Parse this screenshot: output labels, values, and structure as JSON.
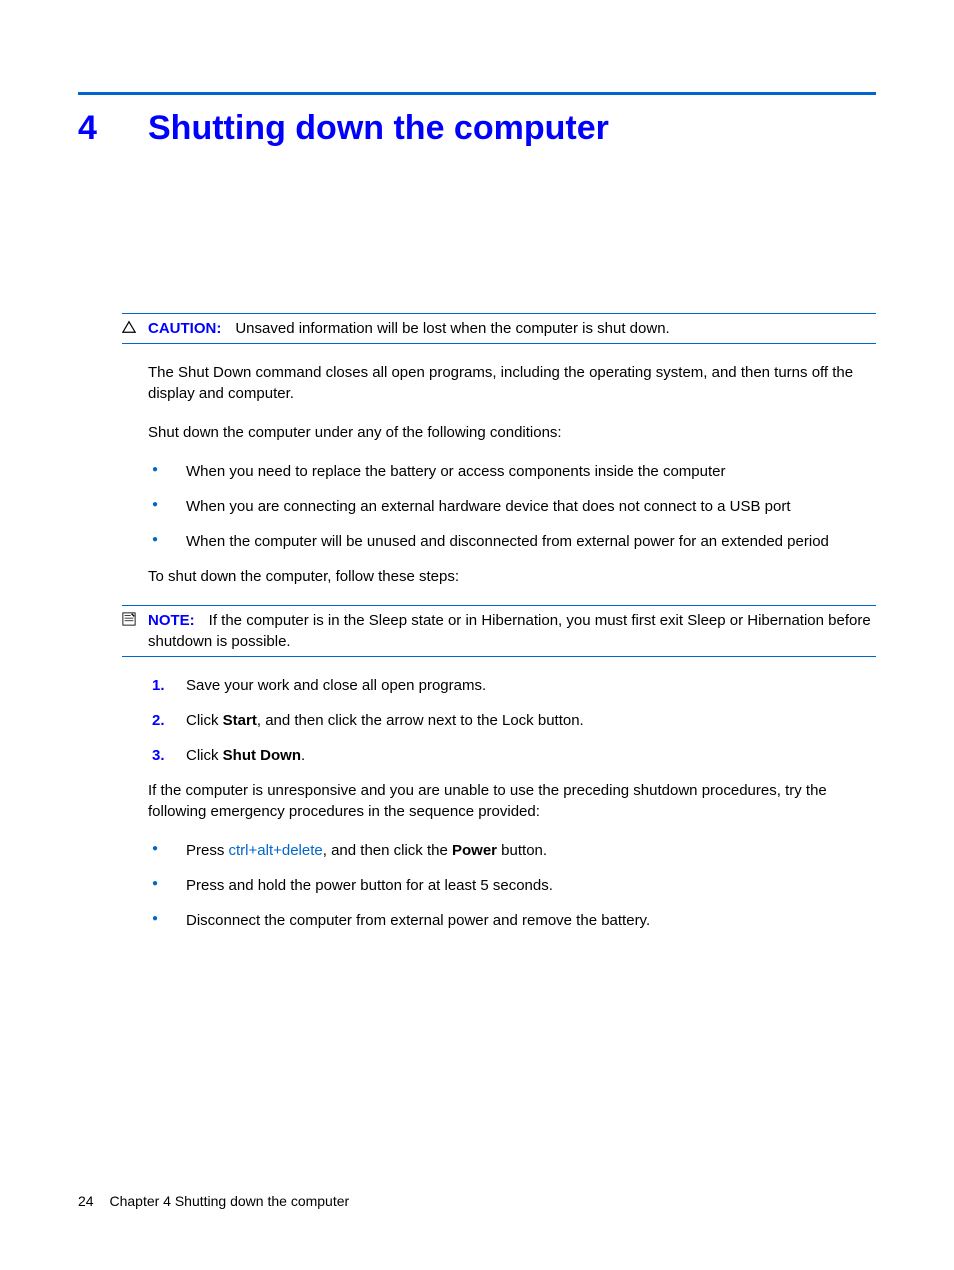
{
  "chapter": {
    "number": "4",
    "title": "Shutting down the computer"
  },
  "caution": {
    "label": "CAUTION:",
    "text": "Unsaved information will be lost when the computer is shut down."
  },
  "paras": {
    "intro1": "The Shut Down command closes all open programs, including the operating system, and then turns off the display and computer.",
    "intro2": "Shut down the computer under any of the following conditions:",
    "steps_intro": "To shut down the computer, follow these steps:",
    "unresponsive": "If the computer is unresponsive and you are unable to use the preceding shutdown procedures, try the following emergency procedures in the sequence provided:"
  },
  "conditions": [
    "When you need to replace the battery or access components inside the computer",
    "When you are connecting an external hardware device that does not connect to a USB port",
    "When the computer will be unused and disconnected from external power for an extended period"
  ],
  "note": {
    "label": "NOTE:",
    "text": "If the computer is in the Sleep state or in Hibernation, you must first exit Sleep or Hibernation before shutdown is possible."
  },
  "steps": [
    {
      "n": "1.",
      "pre": "Save your work and close all open programs."
    },
    {
      "n": "2.",
      "pre": "Click ",
      "bold": "Start",
      "post": ", and then click the arrow next to the Lock button."
    },
    {
      "n": "3.",
      "pre": "Click ",
      "bold": "Shut Down",
      "post": "."
    }
  ],
  "emergency": [
    {
      "pre": "Press ",
      "kbd": "ctrl+alt+delete",
      "mid": ", and then click the ",
      "bold": "Power",
      "post": " button."
    },
    {
      "pre": "Press and hold the power button for at least 5 seconds."
    },
    {
      "pre": "Disconnect the computer from external power and remove the battery."
    }
  ],
  "footer": {
    "page": "24",
    "chapter_label": "Chapter 4   Shutting down the computer"
  }
}
